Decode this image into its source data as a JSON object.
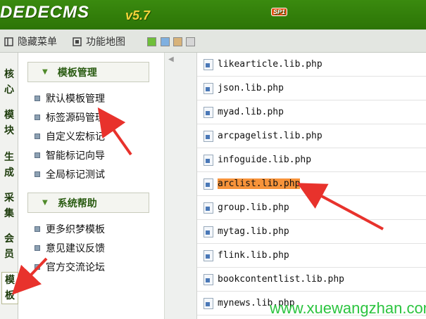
{
  "header": {
    "logo": "DEDECMS",
    "version": "v5.7",
    "sp_badge": "SP1"
  },
  "toolbar": {
    "hide_menu": "隐藏菜单",
    "function_map": "功能地图"
  },
  "vtabs": [
    {
      "label": "核心"
    },
    {
      "label": "模块"
    },
    {
      "label": "生成"
    },
    {
      "label": "采集"
    },
    {
      "label": "会员"
    },
    {
      "label": "模板"
    }
  ],
  "menu": {
    "section1": {
      "title": "模板管理",
      "items": [
        "默认模板管理",
        "标签源码管理",
        "自定义宏标记",
        "智能标记向导",
        "全局标记测试"
      ]
    },
    "section2": {
      "title": "系统帮助",
      "items": [
        "更多织梦模板",
        "意见建议反馈",
        "官方交流论坛"
      ]
    }
  },
  "files": [
    "likearticle.lib.php",
    "json.lib.php",
    "myad.lib.php",
    "arcpagelist.lib.php",
    "infoguide.lib.php",
    "arclist.lib.php",
    "group.lib.php",
    "mytag.lib.php",
    "flink.lib.php",
    "bookcontentlist.lib.php",
    "mynews.lib.php"
  ],
  "highlighted_file": "arclist.lib.php",
  "watermark": "www.xuewangzhan.com",
  "colors": {
    "header_green": "#2c7406",
    "highlight": "#f7933a",
    "arrow": "#e8322c"
  }
}
